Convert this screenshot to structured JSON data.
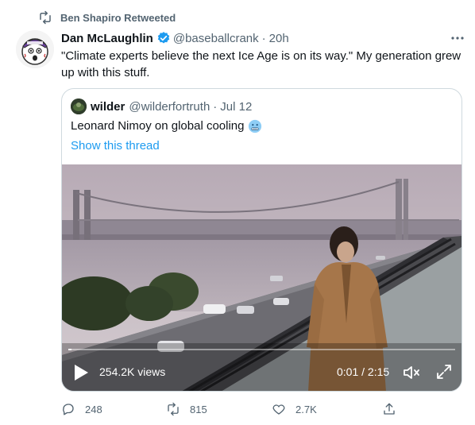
{
  "retweet_context": {
    "text": "Ben Shapiro Retweeted",
    "icon": "retweet-icon"
  },
  "tweet": {
    "author_name": "Dan McLaughlin",
    "author_handle": "@baseballcrank",
    "separator": "·",
    "time": "20h",
    "verified": true,
    "text": "\"Climate experts believe the next Ice Age is on its way.\" My generation grew up with this stuff."
  },
  "quote": {
    "author_name": "wilder",
    "author_handle": "@wilderfortruth",
    "separator": "·",
    "time": "Jul 12",
    "text": "Leonard Nimoy on global cooling",
    "emoji": "cold-face-emoji",
    "thread_link": "Show this thread"
  },
  "video": {
    "views": "254.2K views",
    "time": "0:01 / 2:15",
    "progress_fraction": 0.008
  },
  "actions": {
    "replies": "248",
    "retweets": "815",
    "likes": "2.7K"
  },
  "colors": {
    "accent": "#1d9bf0",
    "muted": "#536471",
    "text": "#0f1419",
    "border": "#cfd9de"
  }
}
